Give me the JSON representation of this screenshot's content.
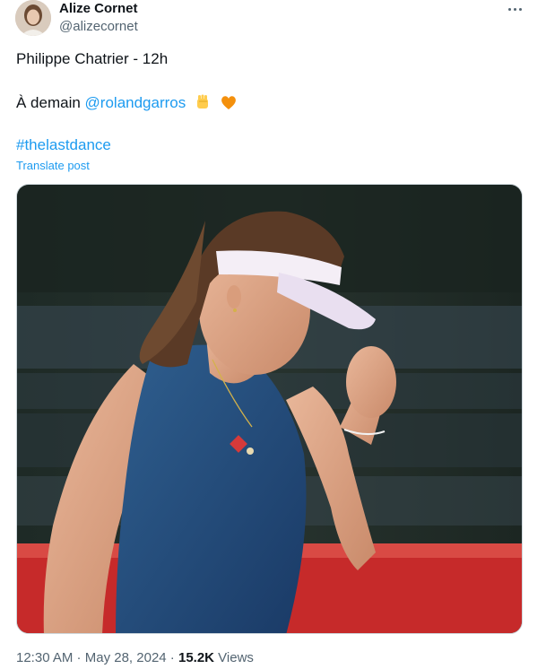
{
  "author": {
    "name": "Alize Cornet",
    "handle": "@alizecornet"
  },
  "tweet": {
    "line1": "Philippe Chatrier - 12h",
    "line2_prefix": "À demain ",
    "mention": "@rolandgarros",
    "emojis": [
      "raised-fist-icon",
      "orange-heart-icon"
    ],
    "hashtag": "#thelastdance",
    "translate_label": "Translate post"
  },
  "media": {
    "icon": "tennis-player-photo"
  },
  "meta": {
    "time": "12:30 AM",
    "sep1": " · ",
    "date": "May 28, 2024",
    "sep2": " · ",
    "views_count": "15.2K",
    "views_label": " Views"
  },
  "colors": {
    "accent": "#1d9bf0",
    "text": "#0f1419",
    "muted": "#536471"
  }
}
